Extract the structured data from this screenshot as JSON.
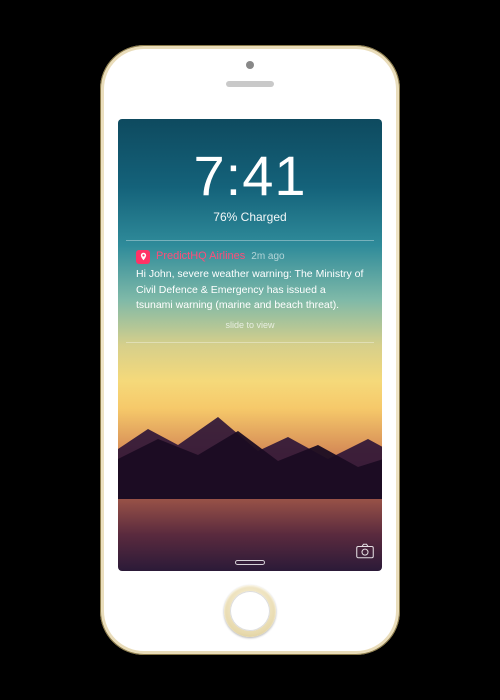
{
  "clock": {
    "time": "7:41",
    "charge": "76% Charged"
  },
  "notification": {
    "app_name": "PredictHQ Airlines",
    "time_ago": "2m ago",
    "body": "Hi John, severe weather warning:\nThe Ministry of Civil Defence & Emergency has issued a tsunami warning (marine and beach threat).",
    "slide_hint": "slide to view"
  }
}
